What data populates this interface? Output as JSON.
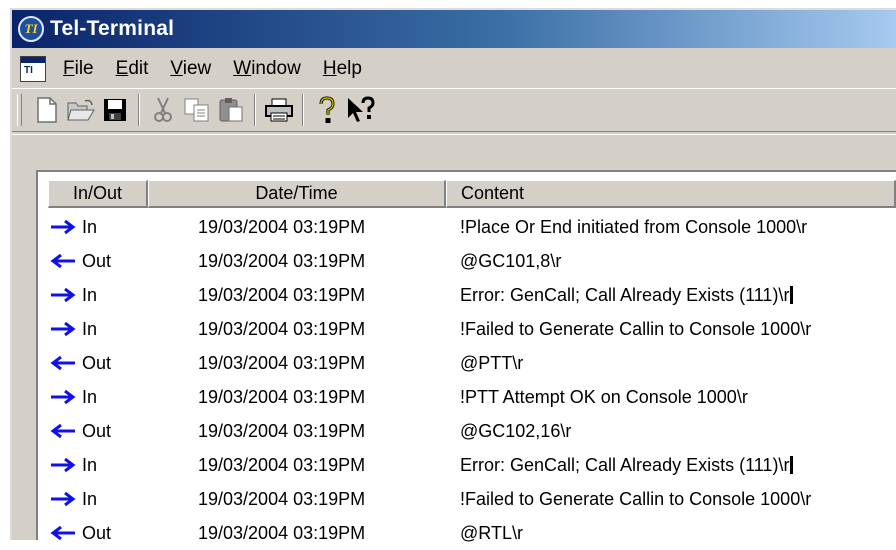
{
  "window": {
    "title": "Tel-Terminal",
    "app_icon_text": "TI",
    "menu_icon_text": "TI"
  },
  "menu": [
    {
      "accel": "F",
      "rest": "ile"
    },
    {
      "accel": "E",
      "rest": "dit"
    },
    {
      "accel": "V",
      "rest": "iew"
    },
    {
      "accel": "W",
      "rest": "indow"
    },
    {
      "accel": "H",
      "rest": "elp"
    }
  ],
  "toolbar": {
    "icons": [
      "new-document-icon",
      "open-folder-icon",
      "save-disk-icon",
      "cut-scissors-icon",
      "copy-icon",
      "paste-icon",
      "print-icon",
      "help-question-icon",
      "context-help-icon"
    ]
  },
  "colors": {
    "arrow": "#1010e8",
    "title_start": "#0a246a",
    "title_end": "#a6caf0",
    "face": "#d4d0c8"
  },
  "table": {
    "headers": {
      "inout": "In/Out",
      "datetime": "Date/Time",
      "content": "Content"
    },
    "rows": [
      {
        "direction": "In",
        "datetime": "19/03/2004 03:19PM",
        "content": "!Place Or End initiated from Console 1000\\r"
      },
      {
        "direction": "Out",
        "datetime": "19/03/2004 03:19PM",
        "content": "@GC101,8\\r"
      },
      {
        "direction": "In",
        "datetime": "19/03/2004 03:19PM",
        "content": "Error: GenCall; Call Already Exists (111)\\r"
      },
      {
        "direction": "In",
        "datetime": "19/03/2004 03:19PM",
        "content": "!Failed to Generate Callin to Console 1000\\r"
      },
      {
        "direction": "Out",
        "datetime": "19/03/2004 03:19PM",
        "content": "@PTT\\r"
      },
      {
        "direction": "In",
        "datetime": "19/03/2004 03:19PM",
        "content": "!PTT Attempt OK on Console 1000\\r"
      },
      {
        "direction": "Out",
        "datetime": "19/03/2004 03:19PM",
        "content": "@GC102,16\\r"
      },
      {
        "direction": "In",
        "datetime": "19/03/2004 03:19PM",
        "content": "Error: GenCall; Call Already Exists (111)\\r"
      },
      {
        "direction": "In",
        "datetime": "19/03/2004 03:19PM",
        "content": "!Failed to Generate Callin to Console 1000\\r"
      },
      {
        "direction": "Out",
        "datetime": "19/03/2004 03:19PM",
        "content": "@RTL\\r"
      }
    ]
  }
}
